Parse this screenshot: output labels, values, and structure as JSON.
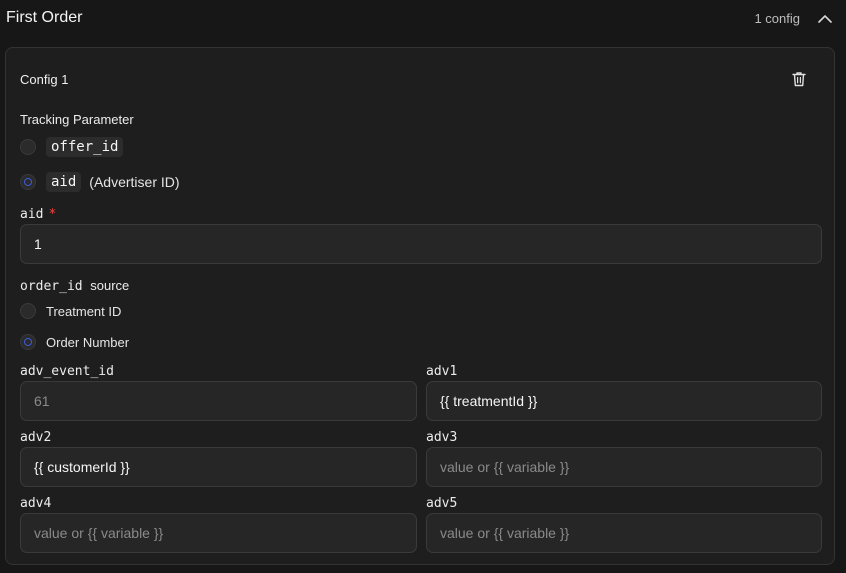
{
  "section": {
    "title": "First Order",
    "count": "1 config",
    "collapse_icon": "chevron-up-icon"
  },
  "config": {
    "title": "Config 1",
    "delete_icon": "trash-icon",
    "tracking_parameter": {
      "label": "Tracking Parameter",
      "options": [
        {
          "code": "offer_id",
          "hint": "",
          "selected": false
        },
        {
          "code": "aid",
          "hint": "(Advertiser ID)",
          "selected": true
        }
      ]
    },
    "aid_field": {
      "label": "aid",
      "required_mark": "*",
      "value": "1"
    },
    "order_id_source": {
      "code": "order_id",
      "suffix": "source",
      "options": [
        {
          "label": "Treatment ID",
          "selected": false
        },
        {
          "label": "Order Number",
          "selected": true
        }
      ]
    },
    "fields": {
      "adv_event_id": {
        "label": "adv_event_id",
        "value": "61",
        "placeholder": ""
      },
      "adv1": {
        "label": "adv1",
        "value": "{{ treatmentId }}",
        "placeholder": ""
      },
      "adv2": {
        "label": "adv2",
        "value": "{{ customerId }}",
        "placeholder": ""
      },
      "adv3": {
        "label": "adv3",
        "value": "",
        "placeholder": "value or {{ variable }}"
      },
      "adv4": {
        "label": "adv4",
        "value": "",
        "placeholder": "value or {{ variable }}"
      },
      "adv5": {
        "label": "adv5",
        "value": "",
        "placeholder": "value or {{ variable }}"
      }
    }
  },
  "colors": {
    "background": "#171717",
    "card": "#1e1e1e",
    "input": "#262626",
    "required": "#ef4444",
    "radio_accent": "#3b5bdb"
  }
}
